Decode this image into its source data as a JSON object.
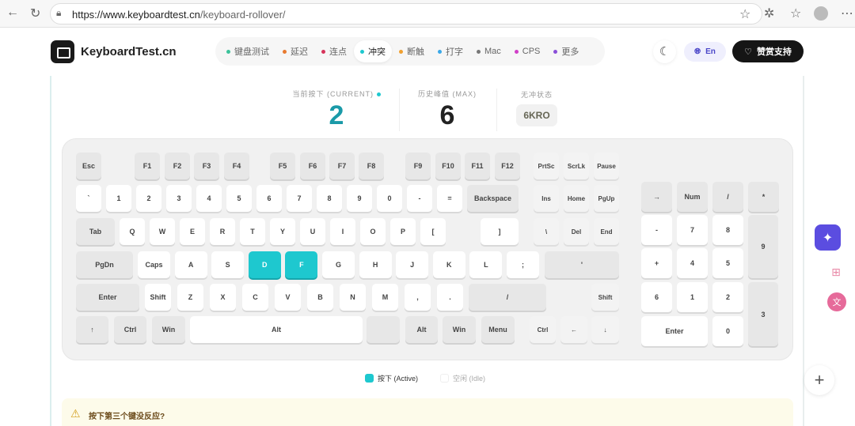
{
  "browser": {
    "url_host": "https://www.keyboardtest.cn",
    "url_path": "/keyboard-rollover/"
  },
  "header": {
    "brand": "KeyboardTest.cn",
    "lang": "En",
    "donate": "赞赏支持",
    "nav": [
      {
        "label": "键盘测试",
        "color": "#3cc29a"
      },
      {
        "label": "延迟",
        "color": "#e87a2f"
      },
      {
        "label": "连点",
        "color": "#d6335a"
      },
      {
        "label": "冲突",
        "color": "#1ec8cf",
        "active": true
      },
      {
        "label": "断触",
        "color": "#f0a030"
      },
      {
        "label": "打字",
        "color": "#3aa8e8"
      },
      {
        "label": "Mac",
        "color": "#777777"
      },
      {
        "label": "CPS",
        "color": "#d13fc8"
      },
      {
        "label": "更多",
        "color": "#8a4fd8"
      }
    ]
  },
  "stats": {
    "current_label": "当前按下 (CURRENT)",
    "current": "2",
    "max_label": "历史峰值 (MAX)",
    "max": "6",
    "status_label": "无冲状态",
    "status": "6KRO"
  },
  "keys": [
    {
      "label": "Esc"
    },
    {
      "label": "F1"
    },
    {
      "label": "F2"
    },
    {
      "label": "F3"
    },
    {
      "label": "F4"
    },
    {
      "label": "F5"
    },
    {
      "label": "F6"
    },
    {
      "label": "F7"
    },
    {
      "label": "F8"
    },
    {
      "label": "F9"
    },
    {
      "label": "F10"
    },
    {
      "label": "F11"
    },
    {
      "label": "F12"
    },
    {
      "label": "PrtSc"
    },
    {
      "label": "ScrLk"
    },
    {
      "label": "Pause"
    },
    {
      "label": "`"
    },
    {
      "label": "1"
    },
    {
      "label": "2"
    },
    {
      "label": "3"
    },
    {
      "label": "4"
    },
    {
      "label": "5"
    },
    {
      "label": "6"
    },
    {
      "label": "7"
    },
    {
      "label": "8"
    },
    {
      "label": "9"
    },
    {
      "label": "0"
    },
    {
      "label": "-"
    },
    {
      "label": "="
    },
    {
      "label": "Backspace"
    },
    {
      "label": "Ins"
    },
    {
      "label": "Home"
    },
    {
      "label": "PgUp"
    },
    {
      "label": "Tab"
    },
    {
      "label": "Q"
    },
    {
      "label": "W"
    },
    {
      "label": "E"
    },
    {
      "label": "R"
    },
    {
      "label": "T"
    },
    {
      "label": "Y"
    },
    {
      "label": "U"
    },
    {
      "label": "I"
    },
    {
      "label": "O"
    },
    {
      "label": "P"
    },
    {
      "label": "["
    },
    {
      "label": "]"
    },
    {
      "label": "\\"
    },
    {
      "label": "Del"
    },
    {
      "label": "End"
    },
    {
      "label": "PgDn"
    },
    {
      "label": "Caps"
    },
    {
      "label": "A"
    },
    {
      "label": "S"
    },
    {
      "label": "D",
      "active": true
    },
    {
      "label": "F",
      "active": true
    },
    {
      "label": "G"
    },
    {
      "label": "H"
    },
    {
      "label": "J"
    },
    {
      "label": "K"
    },
    {
      "label": "L"
    },
    {
      "label": ";"
    },
    {
      "label": "'"
    },
    {
      "label": "Enter"
    },
    {
      "label": "Shift"
    },
    {
      "label": "Z"
    },
    {
      "label": "X"
    },
    {
      "label": "C"
    },
    {
      "label": "V"
    },
    {
      "label": "B"
    },
    {
      "label": "N"
    },
    {
      "label": "M"
    },
    {
      "label": ","
    },
    {
      "label": "."
    },
    {
      "label": "/"
    },
    {
      "label": "Shift"
    },
    {
      "label": "↑"
    },
    {
      "label": "Ctrl"
    },
    {
      "label": "Win"
    },
    {
      "label": "Alt"
    },
    {
      "label": ""
    },
    {
      "label": "Alt"
    },
    {
      "label": "Win"
    },
    {
      "label": "Menu"
    },
    {
      "label": "Ctrl"
    },
    {
      "label": "←"
    },
    {
      "label": "↓"
    },
    {
      "label": "→"
    },
    {
      "label": "Num"
    },
    {
      "label": "/"
    },
    {
      "label": "*"
    },
    {
      "label": "-"
    },
    {
      "label": "7"
    },
    {
      "label": "8"
    },
    {
      "label": "9"
    },
    {
      "label": "+"
    },
    {
      "label": "4"
    },
    {
      "label": "5"
    },
    {
      "label": "6"
    },
    {
      "label": "1"
    },
    {
      "label": "2"
    },
    {
      "label": "3"
    },
    {
      "label": "Enter"
    },
    {
      "label": "0"
    },
    {
      "label": "."
    }
  ],
  "legend": {
    "active": "按下 (Active)",
    "idle": "空闲 (Idle)",
    "active_color": "#1ec8cf"
  },
  "warning": {
    "title": "按下第三个键没反应?"
  }
}
